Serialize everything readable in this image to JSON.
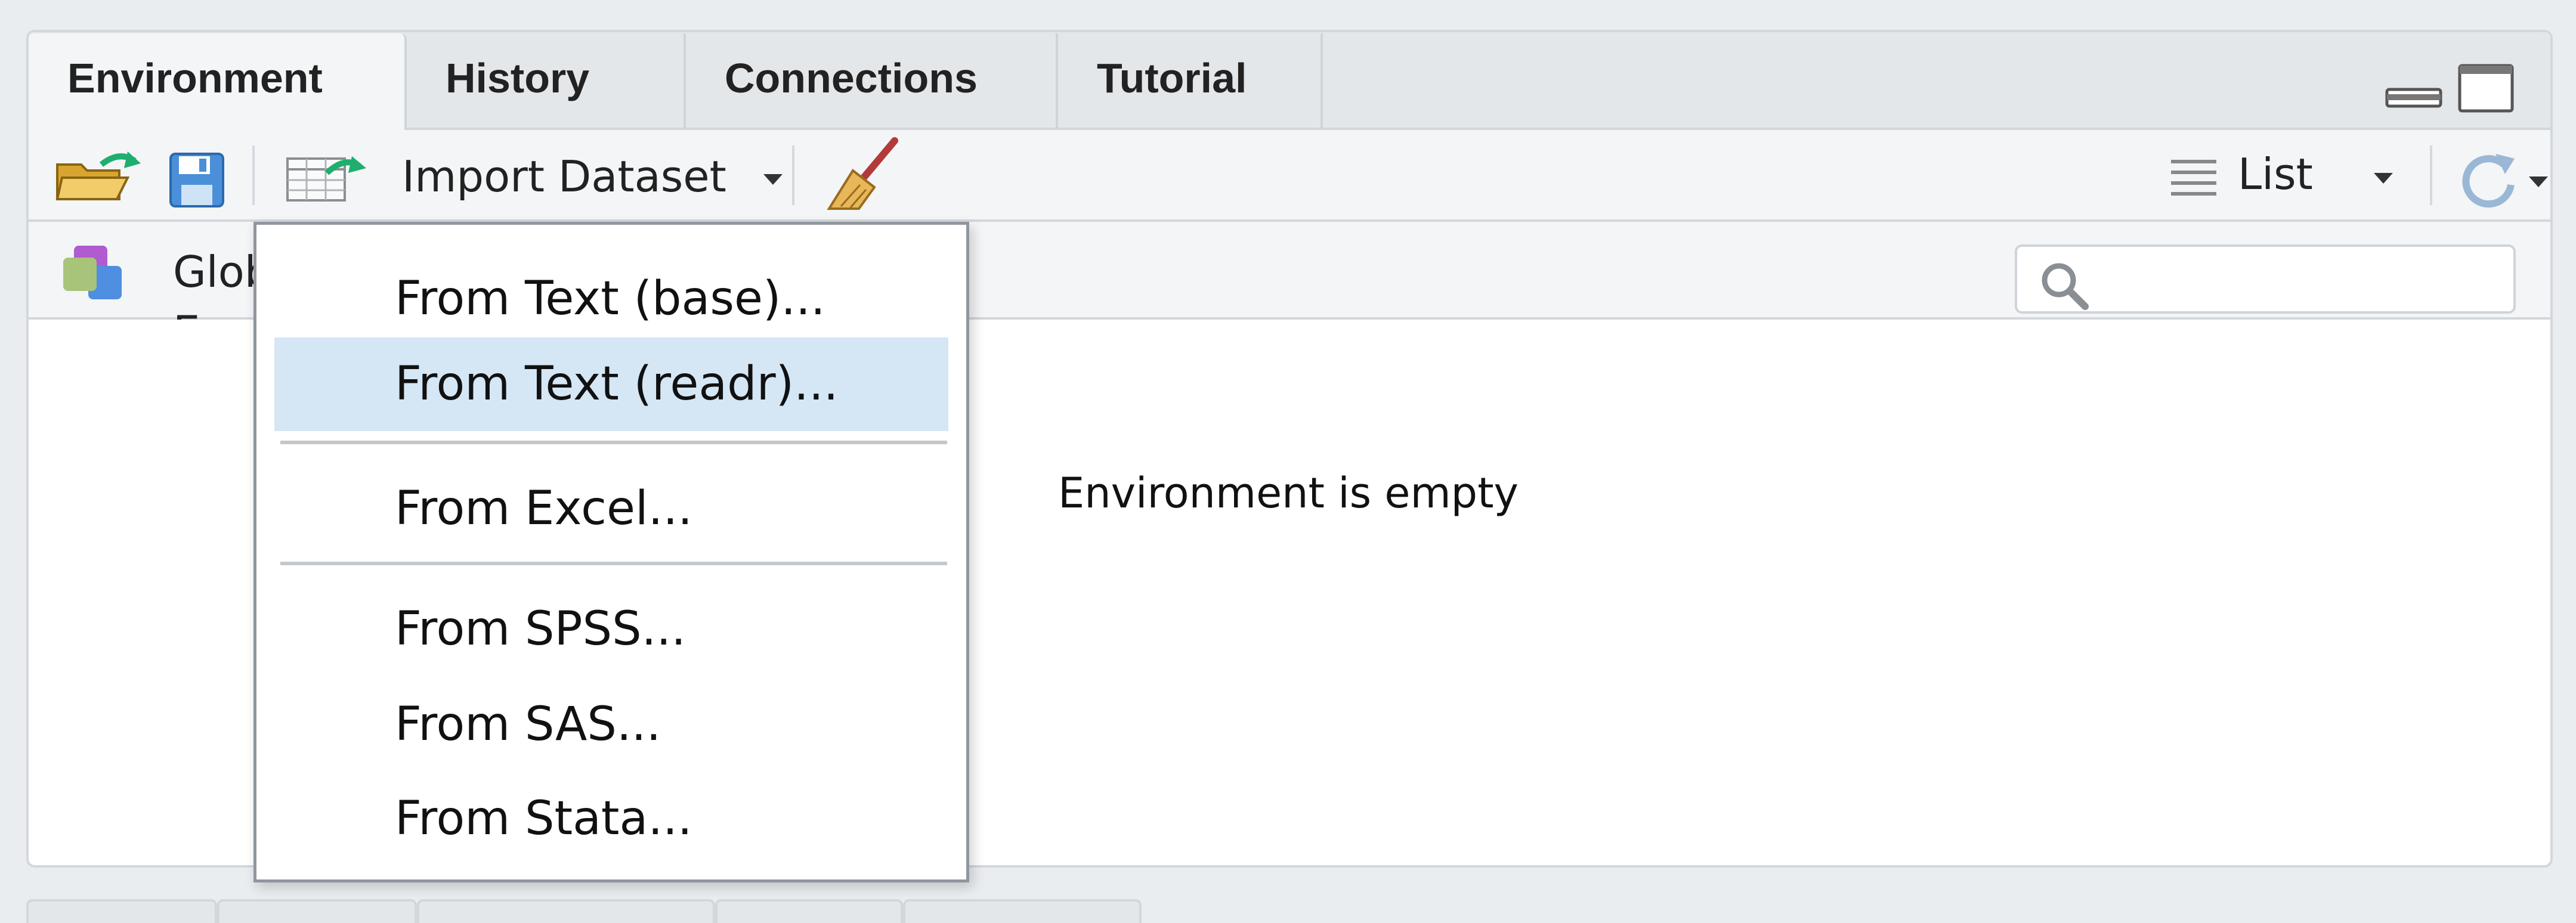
{
  "tabs": [
    {
      "label": "Environment",
      "active": true
    },
    {
      "label": "History",
      "active": false
    },
    {
      "label": "Connections",
      "active": false
    },
    {
      "label": "Tutorial",
      "active": false
    }
  ],
  "toolbar": {
    "import_label": "Import Dataset",
    "view_mode_label": "List"
  },
  "env_scope": {
    "label": "Global Environment"
  },
  "search": {
    "placeholder": ""
  },
  "content": {
    "empty_message": "Environment is empty"
  },
  "import_menu": {
    "items": [
      {
        "label": "From Text (base)...",
        "highlighted": false
      },
      {
        "label": "From Text (readr)...",
        "highlighted": true
      },
      {
        "label": "From Excel...",
        "highlighted": false
      },
      {
        "label": "From SPSS...",
        "highlighted": false
      },
      {
        "label": "From SAS...",
        "highlighted": false
      },
      {
        "label": "From Stata...",
        "highlighted": false
      }
    ]
  },
  "colors": {
    "highlight": "#d5e6f5",
    "accent_green": "#1fae6e",
    "save_blue": "#4a8fd8"
  }
}
